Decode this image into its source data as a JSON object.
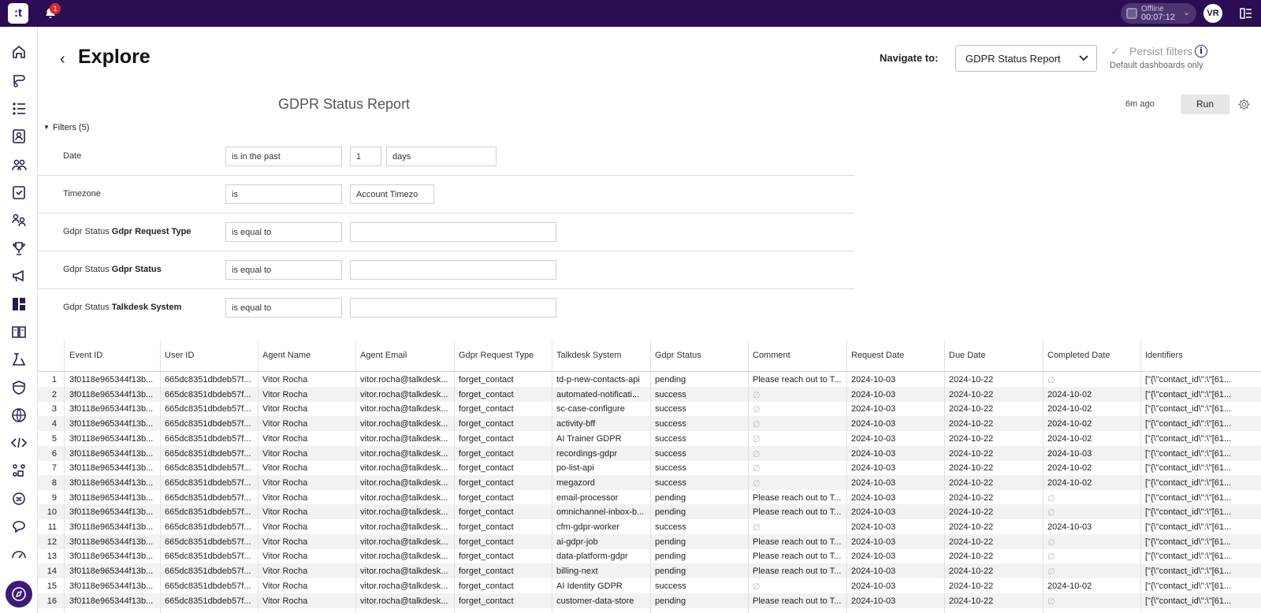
{
  "topbar": {
    "logo_text": ":t",
    "notification_count": "1",
    "status_label": "Offline",
    "status_time": "00:07:12",
    "avatar_initials": "VR"
  },
  "sidebar": {
    "items": [
      "home-icon",
      "conversations-icon",
      "list-icon",
      "contacts-icon",
      "team-icon",
      "tasks-icon",
      "users-icon",
      "trophy-icon",
      "campaigns-icon",
      "dashboard-icon",
      "knowledge-icon",
      "flow-icon",
      "shield-icon",
      "globe-icon",
      "code-icon",
      "integrations-icon",
      "ai-icon",
      "chat-icon",
      "speed-icon",
      "explore-icon"
    ],
    "active": "explore-icon"
  },
  "header": {
    "title": "Explore",
    "navigate_label": "Navigate to:",
    "navigate_value": "GDPR Status Report",
    "persist_label": "Persist filters",
    "persist_sub": "Default dashboards only"
  },
  "report": {
    "title": "GDPR Status Report",
    "updated": "6m ago",
    "run_label": "Run",
    "filters_toggle": "Filters (5)"
  },
  "filters": [
    {
      "prefix": "Date",
      "field": "",
      "operator": "is in the past",
      "values": [
        "1",
        "days"
      ]
    },
    {
      "prefix": "Timezone",
      "field": "",
      "operator": "is",
      "values": [
        "Account Timezo"
      ]
    },
    {
      "prefix": "Gdpr Status ",
      "field": "Gdpr Request Type",
      "operator": "is equal to",
      "values": [
        ""
      ]
    },
    {
      "prefix": "Gdpr Status ",
      "field": "Gdpr Status",
      "operator": "is equal to",
      "values": [
        ""
      ]
    },
    {
      "prefix": "Gdpr Status ",
      "field": "Talkdesk System",
      "operator": "is equal to",
      "values": [
        ""
      ]
    }
  ],
  "table": {
    "columns": [
      "Event ID",
      "User ID",
      "Agent Name",
      "Agent Email",
      "Gdpr Request Type",
      "Talkdesk System",
      "Gdpr Status",
      "Comment",
      "Request Date",
      "Due Date",
      "Completed Date",
      "Identifiers"
    ],
    "null_symbol": "∅",
    "rows": [
      [
        "1",
        "3f0118e965344f13b...",
        "665dc8351dbdeb57f...",
        "Vitor Rocha",
        "vitor.rocha@talkdesk...",
        "forget_contact",
        "td-p-new-contacts-api",
        "pending",
        "Please reach out to T...",
        "2024-10-03",
        "2024-10-22",
        "∅",
        "[\"{\\\"contact_id\\\":\\\"[61..."
      ],
      [
        "2",
        "3f0118e965344f13b...",
        "665dc8351dbdeb57f...",
        "Vitor Rocha",
        "vitor.rocha@talkdesk...",
        "forget_contact",
        "automated-notificati...",
        "success",
        "∅",
        "2024-10-03",
        "2024-10-22",
        "2024-10-02",
        "[\"{\\\"contact_id\\\":\\\"[61..."
      ],
      [
        "3",
        "3f0118e965344f13b...",
        "665dc8351dbdeb57f...",
        "Vitor Rocha",
        "vitor.rocha@talkdesk...",
        "forget_contact",
        "sc-case-configure",
        "success",
        "∅",
        "2024-10-03",
        "2024-10-22",
        "2024-10-02",
        "[\"{\\\"contact_id\\\":\\\"[61..."
      ],
      [
        "4",
        "3f0118e965344f13b...",
        "665dc8351dbdeb57f...",
        "Vitor Rocha",
        "vitor.rocha@talkdesk...",
        "forget_contact",
        "activity-bff",
        "success",
        "∅",
        "2024-10-03",
        "2024-10-22",
        "2024-10-02",
        "[\"{\\\"contact_id\\\":\\\"[61..."
      ],
      [
        "5",
        "3f0118e965344f13b...",
        "665dc8351dbdeb57f...",
        "Vitor Rocha",
        "vitor.rocha@talkdesk...",
        "forget_contact",
        "AI Trainer GDPR",
        "success",
        "∅",
        "2024-10-03",
        "2024-10-22",
        "2024-10-02",
        "[\"{\\\"contact_id\\\":\\\"[61..."
      ],
      [
        "6",
        "3f0118e965344f13b...",
        "665dc8351dbdeb57f...",
        "Vitor Rocha",
        "vitor.rocha@talkdesk...",
        "forget_contact",
        "recordings-gdpr",
        "success",
        "∅",
        "2024-10-03",
        "2024-10-22",
        "2024-10-03",
        "[\"{\\\"contact_id\\\":\\\"[61..."
      ],
      [
        "7",
        "3f0118e965344f13b...",
        "665dc8351dbdeb57f...",
        "Vitor Rocha",
        "vitor.rocha@talkdesk...",
        "forget_contact",
        "po-list-api",
        "success",
        "∅",
        "2024-10-03",
        "2024-10-22",
        "2024-10-02",
        "[\"{\\\"contact_id\\\":\\\"[61..."
      ],
      [
        "8",
        "3f0118e965344f13b...",
        "665dc8351dbdeb57f...",
        "Vitor Rocha",
        "vitor.rocha@talkdesk...",
        "forget_contact",
        "megazord",
        "success",
        "∅",
        "2024-10-03",
        "2024-10-22",
        "2024-10-02",
        "[\"{\\\"contact_id\\\":\\\"[61..."
      ],
      [
        "9",
        "3f0118e965344f13b...",
        "665dc8351dbdeb57f...",
        "Vitor Rocha",
        "vitor.rocha@talkdesk...",
        "forget_contact",
        "email-processor",
        "pending",
        "Please reach out to T...",
        "2024-10-03",
        "2024-10-22",
        "∅",
        "[\"{\\\"contact_id\\\":\\\"[61..."
      ],
      [
        "10",
        "3f0118e965344f13b...",
        "665dc8351dbdeb57f...",
        "Vitor Rocha",
        "vitor.rocha@talkdesk...",
        "forget_contact",
        "omnichannel-inbox-b...",
        "pending",
        "Please reach out to T...",
        "2024-10-03",
        "2024-10-22",
        "∅",
        "[\"{\\\"contact_id\\\":\\\"[61..."
      ],
      [
        "11",
        "3f0118e965344f13b...",
        "665dc8351dbdeb57f...",
        "Vitor Rocha",
        "vitor.rocha@talkdesk...",
        "forget_contact",
        "cfm-gdpr-worker",
        "success",
        "∅",
        "2024-10-03",
        "2024-10-22",
        "2024-10-03",
        "[\"{\\\"contact_id\\\":\\\"[61..."
      ],
      [
        "12",
        "3f0118e965344f13b...",
        "665dc8351dbdeb57f...",
        "Vitor Rocha",
        "vitor.rocha@talkdesk...",
        "forget_contact",
        "ai-gdpr-job",
        "pending",
        "Please reach out to T...",
        "2024-10-03",
        "2024-10-22",
        "∅",
        "[\"{\\\"contact_id\\\":\\\"[61..."
      ],
      [
        "13",
        "3f0118e965344f13b...",
        "665dc8351dbdeb57f...",
        "Vitor Rocha",
        "vitor.rocha@talkdesk...",
        "forget_contact",
        "data-platform-gdpr",
        "pending",
        "Please reach out to T...",
        "2024-10-03",
        "2024-10-22",
        "∅",
        "[\"{\\\"contact_id\\\":\\\"[61..."
      ],
      [
        "14",
        "3f0118e965344f13b...",
        "665dc8351dbdeb57f...",
        "Vitor Rocha",
        "vitor.rocha@talkdesk...",
        "forget_contact",
        "billing-next",
        "pending",
        "Please reach out to T...",
        "2024-10-03",
        "2024-10-22",
        "∅",
        "[\"{\\\"contact_id\\\":\\\"[61..."
      ],
      [
        "15",
        "3f0118e965344f13b...",
        "665dc8351dbdeb57f...",
        "Vitor Rocha",
        "vitor.rocha@talkdesk...",
        "forget_contact",
        "AI Identity GDPR",
        "success",
        "∅",
        "2024-10-03",
        "2024-10-22",
        "2024-10-02",
        "[\"{\\\"contact_id\\\":\\\"[61..."
      ],
      [
        "16",
        "3f0118e965344f13b...",
        "665dc8351dbdeb57f...",
        "Vitor Rocha",
        "vitor.rocha@talkdesk...",
        "forget_contact",
        "customer-data-store",
        "pending",
        "Please reach out to T...",
        "2024-10-03",
        "2024-10-22",
        "∅",
        "[\"{\\\"contact_id\\\":\\\"[61..."
      ]
    ]
  },
  "colors": {
    "topbar": "#2a0d52",
    "accent": "#3d1a78",
    "badge": "#e0262b"
  }
}
